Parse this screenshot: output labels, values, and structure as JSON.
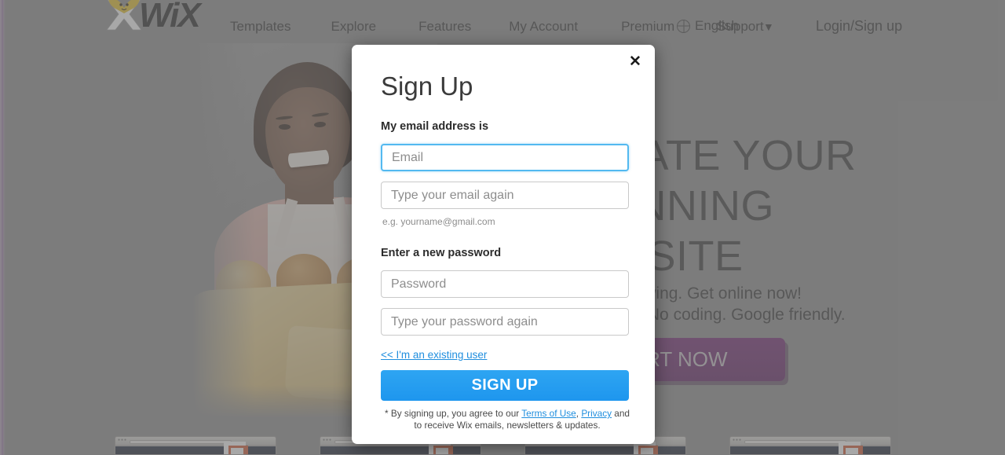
{
  "site": {
    "brand": "WiX",
    "logo_icon": "wix-star-logo-icon"
  },
  "topnav": {
    "links": [
      {
        "label": "Templates"
      },
      {
        "label": "Explore"
      },
      {
        "label": "Features"
      },
      {
        "label": "My Account"
      },
      {
        "label": "Premium"
      },
      {
        "label": "Support"
      }
    ],
    "language": {
      "icon": "globe-icon",
      "label": "English",
      "caret": "▼"
    },
    "login_label": "Login/Sign up"
  },
  "hero": {
    "headline_line1": "CREATE YOUR",
    "headline_line2": "STUNNING",
    "headline_line3": "WEBSITE",
    "sub_line1": "Free and growing. Get online now!",
    "sub_line2": "Drag & drop. No coding. Google friendly.",
    "cta_label": "START NOW"
  },
  "modal": {
    "title": "Sign Up",
    "close_label": "✕",
    "close_icon": "close-icon",
    "email_section_label": "My email address is",
    "email_placeholder": "Email",
    "email_value": "",
    "email_confirm_placeholder": "Type your email again",
    "email_confirm_value": "",
    "email_hint": "e.g. yourname@gmail.com",
    "password_section_label": "Enter a new password",
    "password_placeholder": "Password",
    "password_value": "",
    "password_confirm_placeholder": "Type your password again",
    "password_confirm_value": "",
    "existing_user_link": "<< I'm an existing user",
    "submit_label": "SIGN UP",
    "legal_prefix": "* By signing up, you agree to our ",
    "legal_terms_link": "Terms of Use",
    "legal_sep": ", ",
    "legal_privacy_link": "Privacy",
    "legal_suffix": " and to receive Wix emails, newsletters & updates."
  },
  "colors": {
    "accent_blue": "#1e96ee",
    "link_blue": "#1f8ede",
    "focus_blue": "#53b9f0",
    "cta_purple": "#6e1f6e",
    "page_dim": "#8c8c8c"
  },
  "thumbnails": [
    {
      "name": "site-thumbnail"
    },
    {
      "name": "site-thumbnail"
    },
    {
      "name": "site-thumbnail"
    },
    {
      "name": "site-thumbnail"
    }
  ]
}
